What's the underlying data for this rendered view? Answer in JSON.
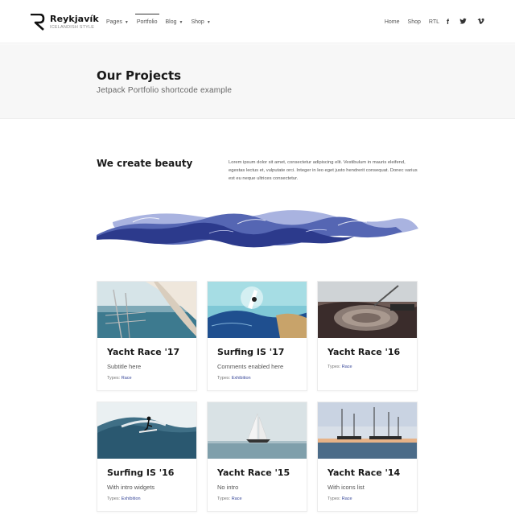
{
  "site": {
    "name": "Reykjavík",
    "tagline": "ICELANDISH STYLE"
  },
  "nav": {
    "left": [
      {
        "label": "Pages",
        "has_dropdown": true
      },
      {
        "label": "Portfolio",
        "has_dropdown": false,
        "active": true
      },
      {
        "label": "Blog",
        "has_dropdown": true
      },
      {
        "label": "Shop",
        "has_dropdown": true
      }
    ],
    "right": [
      {
        "label": "Home"
      },
      {
        "label": "Shop"
      },
      {
        "label": "RTL"
      }
    ],
    "social": [
      {
        "icon": "facebook-icon",
        "glyph": "f"
      },
      {
        "icon": "twitter-icon",
        "glyph": "🐦"
      },
      {
        "icon": "vimeo-icon",
        "glyph": "v"
      }
    ]
  },
  "page": {
    "title": "Our Projects",
    "subtitle": "Jetpack Portfolio shortcode example"
  },
  "intro": {
    "heading": "We create beauty",
    "text": "Lorem ipsum dolor sit amet, consectetur adipiscing elit. Vestibulum in mauris eleifend, egestas lectus et, vulputate orci. Integer in leo eget justo hendrerit consequat. Donec varius est eu neque ultrices consectetur."
  },
  "types_label": "Types:",
  "projects": [
    {
      "title": "Yacht Race '17",
      "subtitle": "Subtitle here",
      "type": "Race",
      "image": "sailboat-deck-image"
    },
    {
      "title": "Surfing IS '17",
      "subtitle": "Comments enabled here",
      "type": "Exhibition",
      "image": "wave-jump-image"
    },
    {
      "title": "Yacht Race '16",
      "subtitle": "",
      "type": "Race",
      "image": "boat-rope-image"
    },
    {
      "title": "Surfing IS '16",
      "subtitle": "With intro widgets",
      "type": "Exhibition",
      "image": "surfer-image"
    },
    {
      "title": "Yacht Race '15",
      "subtitle": "No intro",
      "type": "Race",
      "image": "sailboat-sea-image"
    },
    {
      "title": "Yacht Race '14",
      "subtitle": "With icons list",
      "type": "Race",
      "image": "harbor-sunset-image"
    }
  ],
  "colors": {
    "accent": "#3b4a9a",
    "wave_dark": "#2c3a8c",
    "wave_mid": "#5566b3",
    "wave_light": "#a9b3e0"
  }
}
